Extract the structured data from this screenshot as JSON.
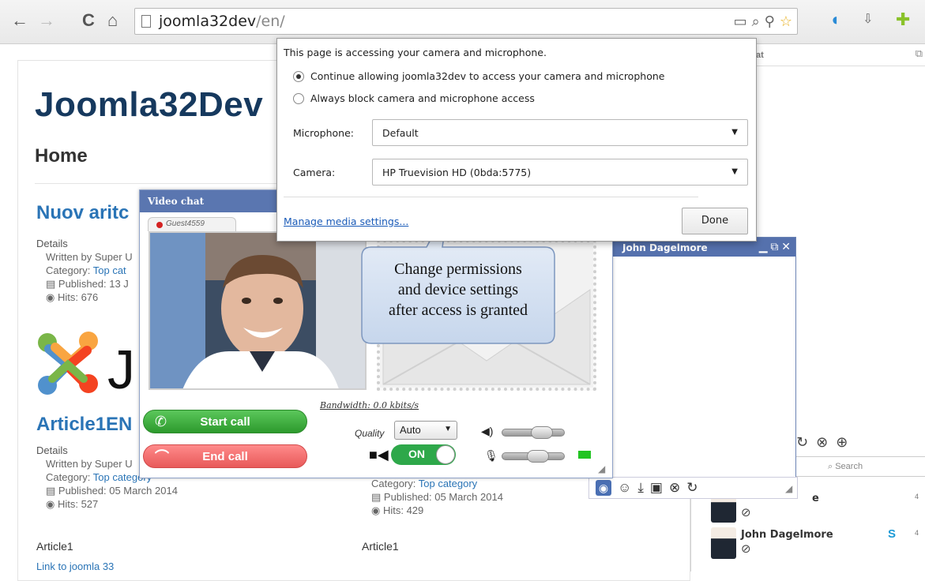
{
  "browser": {
    "url_host": "joomla32dev",
    "url_path": "/en/",
    "back_glyph": "←",
    "forward_glyph": "→",
    "reload_glyph": "C",
    "home_glyph": "⌂"
  },
  "page": {
    "site_title": "Joomla32Dev",
    "home_title": "Home",
    "articles": [
      {
        "title": "Nuov aritc",
        "details_label": "Details",
        "written_by": "Written by Super U",
        "category_prefix": "Category: ",
        "category": "Top cat",
        "published": "Published: 13 J",
        "hits": "Hits: 676"
      },
      {
        "title": "Article1EN",
        "details_label": "Details",
        "written_by": "Written by Super U",
        "category_prefix": "Category: ",
        "category": "Top category",
        "published": "Published: 05 March 2014",
        "hits": "Hits: 527",
        "body": "Article1",
        "link": "Link to joomla 33"
      },
      {
        "category_prefix": "Category: ",
        "category": "Top category",
        "published": "Published: 05 March 2014",
        "hits": "Hits: 429",
        "body": "Article1"
      }
    ],
    "logo_letter": "J"
  },
  "permission_popup": {
    "heading": "This page is accessing your camera and microphone.",
    "option_allow": "Continue allowing joomla32dev to access your camera and microphone",
    "option_block": "Always block camera and microphone access",
    "microphone_label": "Microphone:",
    "microphone_value": "Default",
    "camera_label": "Camera:",
    "camera_value": "HP Truevision HD (0bda:5775)",
    "manage_link": "Manage media settings...",
    "done_label": "Done"
  },
  "video_chat": {
    "title": "Video chat",
    "guest_name": "Guest4559",
    "bandwidth": "Bandwidth: 0.0 kbits/s",
    "start_call": "Start call",
    "end_call": "End call",
    "quality_label": "Quality",
    "quality_value": "Auto",
    "camera_toggle": "ON",
    "speaker_volume": 0.7,
    "mic_volume": 0.6
  },
  "callout": {
    "line1": "Change permissions",
    "line2": "and device settings",
    "line3": "after access is granted"
  },
  "chat_window": {
    "title": "John Dagelmore"
  },
  "chat_panel": {
    "header_fragment": "at",
    "search_placeholder": "Search",
    "contacts": [
      {
        "name": "e",
        "num": "4"
      },
      {
        "name": "John Dagelmore",
        "num": "4"
      }
    ]
  },
  "colors": {
    "accent_blue": "#5571ad",
    "start_green": "#2d9a2d",
    "end_red": "#e85a5a",
    "toggle_green": "#2ea84a",
    "link_blue": "#2a74b6"
  }
}
